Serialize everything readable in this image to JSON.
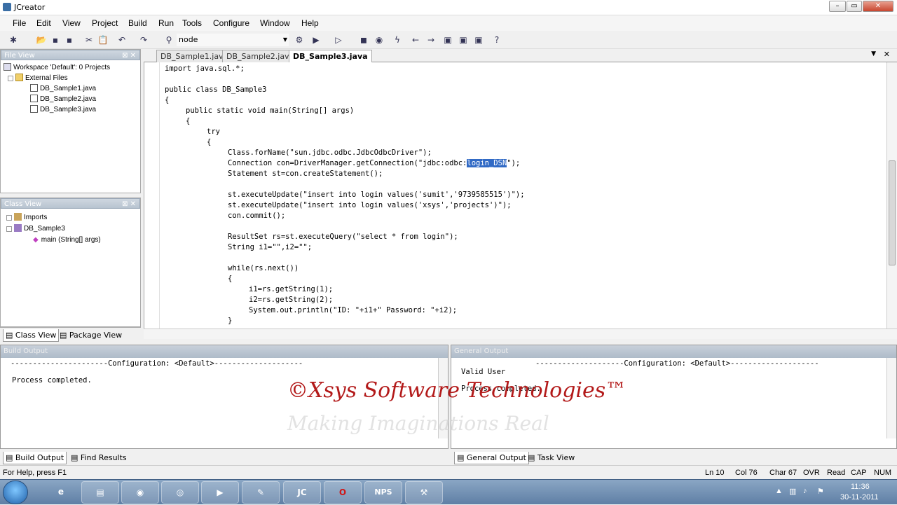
{
  "window": {
    "title": "JCreator"
  },
  "menu": [
    "File",
    "Edit",
    "View",
    "Project",
    "Build",
    "Run",
    "Tools",
    "Configure",
    "Window",
    "Help"
  ],
  "toolbar": {
    "config_select": "node"
  },
  "file_view": {
    "title": "File View",
    "workspace": "Workspace 'Default': 0 Projects",
    "folder": "External Files",
    "files": [
      "DB_Sample1.java",
      "DB_Sample2.java",
      "DB_Sample3.java"
    ]
  },
  "class_view": {
    "title": "Class View",
    "imports": "Imports",
    "class_name": "DB_Sample3",
    "method": "main (String[] args)"
  },
  "left_tabs": [
    "Class View",
    "Package View"
  ],
  "editor": {
    "tabs": [
      "DB_Sample1.java",
      "DB_Sample2.java",
      "DB_Sample3.java"
    ],
    "active_tab": 2
  },
  "code_lines": [
    {
      "indent": 0,
      "text": "import java.sql.*;"
    },
    {
      "indent": 0,
      "text": ""
    },
    {
      "indent": 0,
      "text": "public class DB_Sample3"
    },
    {
      "indent": 0,
      "text": "{"
    },
    {
      "indent": 4,
      "text": "public static void main(String[] args)"
    },
    {
      "indent": 4,
      "text": "{"
    },
    {
      "indent": 8,
      "text": "try"
    },
    {
      "indent": 8,
      "text": "{"
    },
    {
      "indent": 12,
      "text": "Class.forName(\"sun.jdbc.odbc.JdbcOdbcDriver\");"
    },
    {
      "indent": 12,
      "text": "Connection con=DriverManager.getConnection(\"jdbc:odbc:",
      "selected": "login_DSN",
      "after": "\");"
    },
    {
      "indent": 12,
      "text": "Statement st=con.createStatement();"
    },
    {
      "indent": 0,
      "text": ""
    },
    {
      "indent": 12,
      "text": "st.executeUpdate(\"insert into login values('sumit','9739585515')\");"
    },
    {
      "indent": 12,
      "text": "st.executeUpdate(\"insert into login values('xsys','projects')\");"
    },
    {
      "indent": 12,
      "text": "con.commit();"
    },
    {
      "indent": 0,
      "text": ""
    },
    {
      "indent": 12,
      "text": "ResultSet rs=st.executeQuery(\"select * from login\");"
    },
    {
      "indent": 12,
      "text": "String i1=\"\",i2=\"\";"
    },
    {
      "indent": 0,
      "text": ""
    },
    {
      "indent": 12,
      "text": "while(rs.next())"
    },
    {
      "indent": 12,
      "text": "{"
    },
    {
      "indent": 16,
      "text": "i1=rs.getString(1);"
    },
    {
      "indent": 16,
      "text": "i2=rs.getString(2);"
    },
    {
      "indent": 16,
      "text": "System.out.println(\"ID: \"+i1+\" Password: \"+i2);"
    },
    {
      "indent": 12,
      "text": "}"
    }
  ],
  "build_output": {
    "title": "Build Output",
    "config_line": "----------------------Configuration: <Default>--------------------",
    "status": "Process completed."
  },
  "general_output": {
    "title": "General Output",
    "first_line": "Valid User",
    "config_line": "--------------------Configuration: <Default>--------------------",
    "status": "Process completed."
  },
  "bottom_tabs_left": [
    "Build Output",
    "Find Results"
  ],
  "bottom_tabs_right": [
    "General Output",
    "Task View"
  ],
  "watermark": {
    "text": "©Xsys Software Technologies™",
    "tagline": "Making Imaginations Real"
  },
  "status": {
    "help": "For Help, press F1",
    "ln": "Ln 10",
    "col": "Col 76",
    "char": "Char 67",
    "ovr": "OVR",
    "read": "Read",
    "cap": "CAP",
    "num": "NUM"
  },
  "taskbar": {
    "time": "11:36",
    "date": "30-11-2011",
    "apps": [
      "ie-icon",
      "explorer-icon",
      "chrome-icon",
      "media-icon",
      "wmp-icon",
      "notepad-icon",
      "jcreator-icon",
      "opera-icon",
      "nps-icon",
      "tools-icon"
    ],
    "nps_label": "NPS"
  }
}
